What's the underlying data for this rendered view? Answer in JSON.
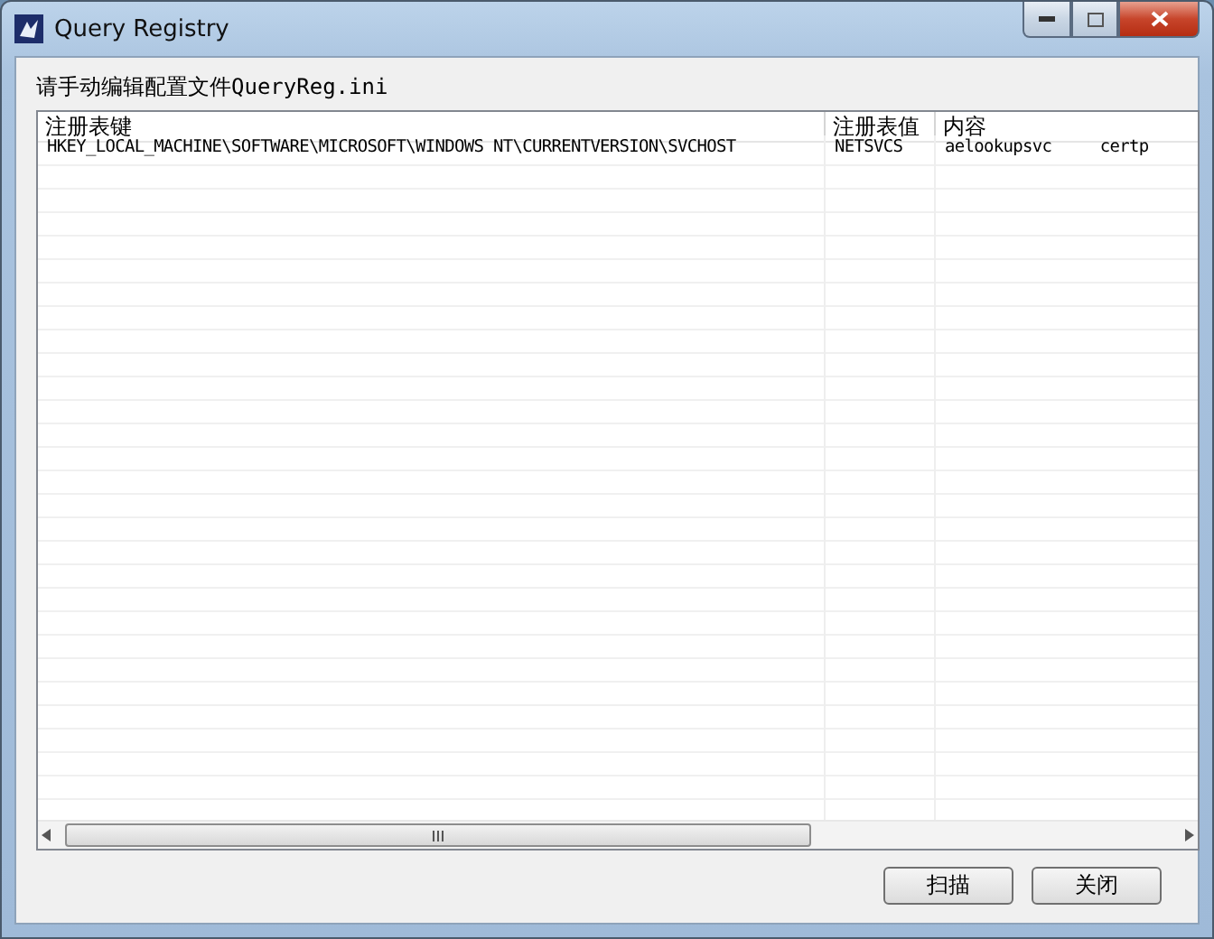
{
  "window": {
    "title": "Query Registry"
  },
  "instruction": "请手动编辑配置文件QueryReg.ini",
  "table": {
    "columns": [
      "注册表键",
      "注册表值",
      "内容"
    ],
    "rows": [
      {
        "cells": [
          "HKEY_LOCAL_MACHINE\\SOFTWARE\\MICROSOFT\\WINDOWS NT\\CURRENTVERSION\\SVCHOST",
          "NETSVCS",
          "aelookupsvc     certp"
        ]
      }
    ]
  },
  "buttons": [
    {
      "label": "扫描"
    },
    {
      "label": "关闭"
    }
  ]
}
